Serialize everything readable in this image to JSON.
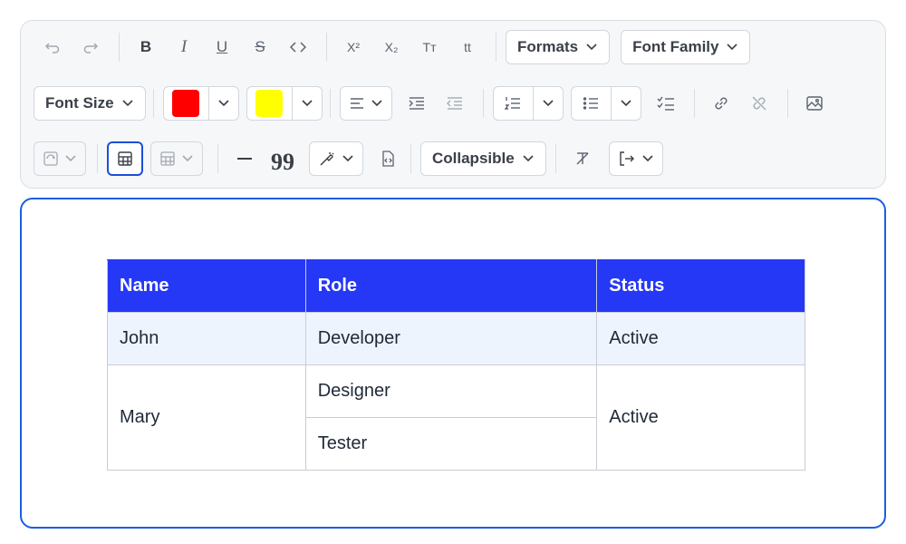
{
  "toolbar": {
    "formats_label": "Formats",
    "font_family_label": "Font Family",
    "font_size_label": "Font Size",
    "collapsible_label": "Collapsible",
    "text_color": "#ff0000",
    "highlight_color": "#ffff00",
    "superscript_label": "X²",
    "subscript_label": "X₂",
    "uppercase_label": "Tт",
    "lowercase_label": "tt"
  },
  "editor": {
    "table": {
      "headers": [
        "Name",
        "Role",
        "Status"
      ],
      "rows": [
        {
          "name": "John",
          "role": "Developer",
          "status": "Active"
        },
        {
          "name": "Mary",
          "roles": [
            "Designer",
            "Tester"
          ],
          "status": "Active"
        }
      ]
    }
  },
  "colors": {
    "accent": "#1a5fe0",
    "header_bg": "#2538f5"
  }
}
